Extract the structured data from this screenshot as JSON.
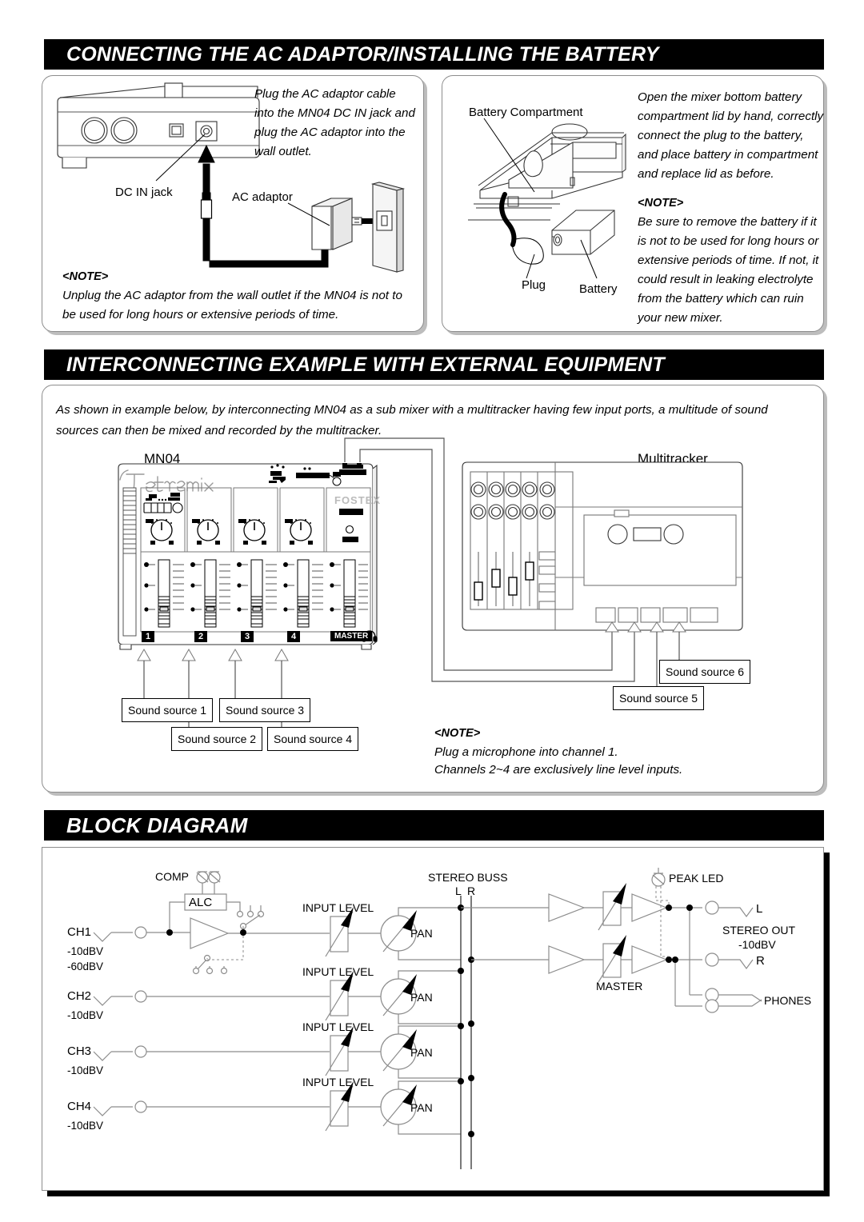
{
  "sections": {
    "ac_battery": {
      "title": "CONNECTING THE AC ADAPTOR/INSTALLING THE BATTERY",
      "ac_panel": {
        "instruction": "Plug the AC adaptor cable into the MN04 DC IN jack and plug the AC adaptor into the wall outlet.",
        "label_dc_in": "DC IN jack",
        "label_ac_adaptor": "AC adaptor",
        "note_label": "<NOTE>",
        "note_text": "Unplug the AC adaptor from the wall outlet if the MN04 is not to be used for long hours or extensive periods of time."
      },
      "battery_panel": {
        "instruction": "Open the mixer bottom battery compartment lid by hand, correctly connect the plug to the battery, and place battery in compartment and replace lid as before.",
        "label_compartment": "Battery Compartment",
        "label_plug": "Plug",
        "label_battery": "Battery",
        "note_label": "<NOTE>",
        "note_text": "Be sure to remove the battery if it is not to be used for long hours or extensive periods of time.  If not, it could result in leaking electrolyte from the battery which can ruin your new mixer."
      }
    },
    "interconnect": {
      "title": "INTERCONNECTING EXAMPLE WITH EXTERNAL EQUIPMENT",
      "intro": "As shown in example below, by interconnecting MN04 as a sub mixer with a multitracker having few input ports, a multitude of sound sources can then be mixed and recorded by the multitracker.",
      "mixer_label": "MN04",
      "mixer_brand_script": "Tetramix",
      "mixer_brand": "Fostex",
      "mixer_model": "MN04",
      "mixer_channel_labels": [
        "1",
        "2",
        "3",
        "4"
      ],
      "mixer_master_label": "MASTER",
      "mixer_knob_labels": {
        "min": "MIN",
        "left": "R",
        "right": "L",
        "max": "MAX"
      },
      "multitracker_label": "Multitracker",
      "sound_sources": [
        "Sound source 1",
        "Sound source 2",
        "Sound source 3",
        "Sound source 4",
        "Sound source 5",
        "Sound source 6"
      ],
      "note_label": "<NOTE>",
      "note_line1": "Plug a microphone into channel 1.",
      "note_line2": "Channels 2~4 are exclusively line level inputs."
    },
    "block_diagram": {
      "title": "BLOCK DIAGRAM",
      "labels": {
        "comp": "COMP",
        "alc": "ALC",
        "stereo_buss": "STEREO BUSS",
        "buss_l": "L",
        "buss_r": "R",
        "peak_led": "PEAK LED",
        "master": "MASTER",
        "stereo_out": "STEREO OUT",
        "stereo_out_level": "-10dBV",
        "out_l": "L",
        "out_r": "R",
        "phones": "PHONES",
        "input_level": "INPUT LEVEL",
        "pan": "PAN"
      },
      "channels": [
        {
          "name": "CH1",
          "levels": [
            "-10dBV",
            "-60dBV"
          ],
          "input_level": "INPUT LEVEL",
          "pan": "PAN"
        },
        {
          "name": "CH2",
          "levels": [
            "-10dBV"
          ],
          "input_level": "INPUT LEVEL",
          "pan": "PAN"
        },
        {
          "name": "CH3",
          "levels": [
            "-10dBV"
          ],
          "input_level": "INPUT LEVEL",
          "pan": "PAN"
        },
        {
          "name": "CH4",
          "levels": [
            "-10dBV"
          ],
          "input_level": "INPUT LEVEL",
          "pan": "PAN"
        }
      ]
    }
  },
  "colors": {
    "bar_bg": "#000000",
    "bar_fg": "#ffffff",
    "panel_border": "#8d8d8d",
    "panel_shadow": "#bdbdbd",
    "line": "#000000",
    "line_grey": "#999999"
  }
}
